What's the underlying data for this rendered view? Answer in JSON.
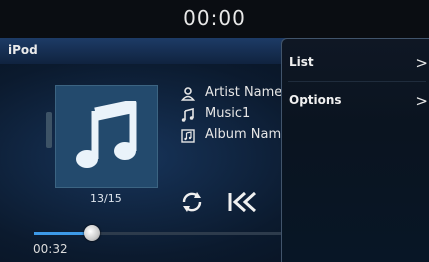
{
  "status_bar": {
    "clock": "00:00"
  },
  "source": {
    "label": "iPod"
  },
  "now_playing": {
    "artist": "Artist Name",
    "song": "Music1",
    "album": "Album Name",
    "track_position": "13/15",
    "elapsed": "00:32",
    "progress_fraction": 0.23
  },
  "icons": {
    "artist": "person-icon",
    "song": "music-note-icon",
    "album": "album-icon",
    "repeat": "repeat-icon",
    "previous": "skip-previous-icon",
    "album_art": "music-note-icon"
  },
  "menu": {
    "items": [
      {
        "label": "List",
        "chevron": ">"
      },
      {
        "label": "Options",
        "chevron": ">"
      }
    ]
  },
  "colors": {
    "accent": "#3d9ae8",
    "art_background": "#234a6d",
    "header_gradient_top": "#1d3b66"
  }
}
